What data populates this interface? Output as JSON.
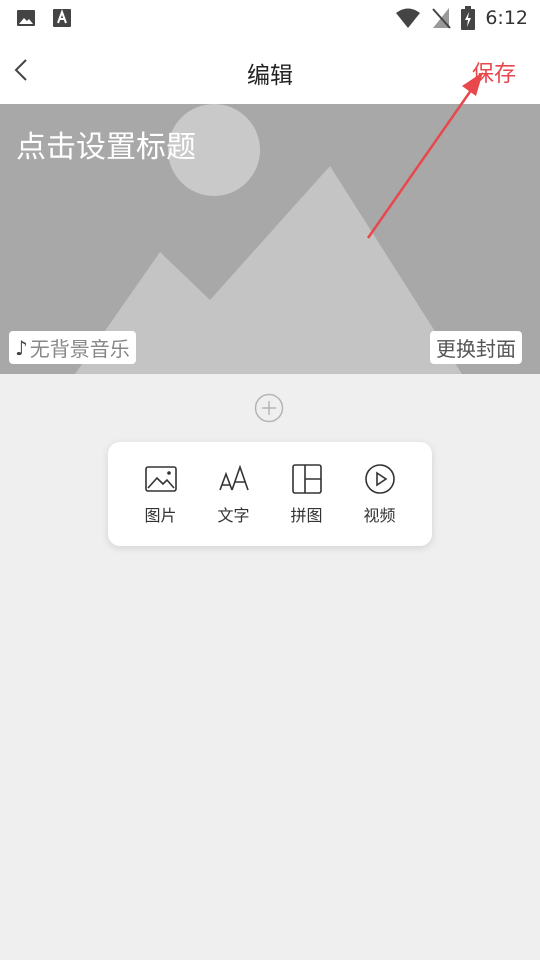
{
  "status_bar": {
    "time": "6:12",
    "icons": [
      "image-icon",
      "text-icon",
      "wifi-icon",
      "no-signal-icon",
      "battery-charging-icon"
    ]
  },
  "header": {
    "title": "编辑",
    "save_label": "保存"
  },
  "cover": {
    "title_prompt": "点击设置标题",
    "music_note": "♪",
    "music_label": "无背景音乐",
    "change_cover_label": "更换封面"
  },
  "insert_menu": {
    "items": [
      {
        "label": "图片",
        "icon": "image-icon"
      },
      {
        "label": "文字",
        "icon": "text-icon"
      },
      {
        "label": "拼图",
        "icon": "collage-icon"
      },
      {
        "label": "视频",
        "icon": "video-icon"
      }
    ]
  },
  "colors": {
    "accent": "#e8474c",
    "cover_bg": "#a8a8a8",
    "page_bg": "#efefef"
  }
}
